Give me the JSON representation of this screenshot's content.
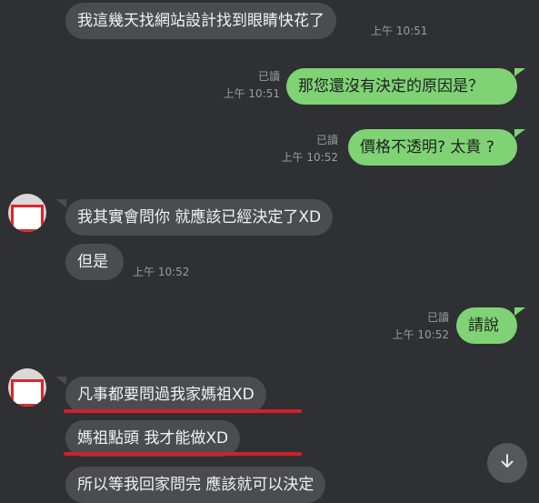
{
  "colors": {
    "background": "#2f3033",
    "incoming_bubble": "#4a4c50",
    "outgoing_bubble": "#7fd375",
    "meta_text": "#9a9b9e",
    "annotation_red": "#d21f2a"
  },
  "messages": [
    {
      "direction": "incoming",
      "text": "我這幾天找網站設計找到眼睛快花了",
      "time": "上午 10:51"
    },
    {
      "direction": "outgoing",
      "text": "那您還沒有決定的原因是？",
      "read": "已讀",
      "time": "上午 10:51"
    },
    {
      "direction": "outgoing",
      "text": "價格不透明? 太貴 ?",
      "read": "已讀",
      "time": "上午 10:52"
    },
    {
      "direction": "incoming",
      "text": "我其實會問你 就應該已經決定了XD",
      "time": ""
    },
    {
      "direction": "incoming",
      "text": "但是",
      "time": "上午 10:52"
    },
    {
      "direction": "outgoing",
      "text": "請說",
      "read": "已讀",
      "time": "上午 10:52"
    },
    {
      "direction": "incoming",
      "text": "凡事都要問過我家媽祖XD",
      "time": ""
    },
    {
      "direction": "incoming",
      "text": "媽祖點頭 我才能做XD",
      "time": ""
    },
    {
      "direction": "incoming",
      "text": "所以等我回家問完 應該就可以決定",
      "time": ""
    }
  ],
  "scroll_button": {
    "icon": "arrow-down-icon"
  }
}
